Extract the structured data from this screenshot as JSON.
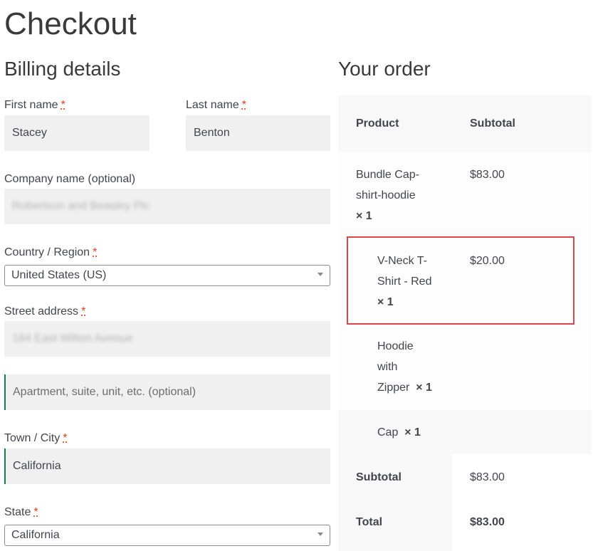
{
  "page": {
    "title": "Checkout"
  },
  "billing": {
    "title": "Billing details",
    "required_mark": "*",
    "first_name": {
      "label": "First name",
      "value": "Stacey"
    },
    "last_name": {
      "label": "Last name",
      "value": "Benton"
    },
    "company": {
      "label": "Company name (optional)",
      "value": "Robertson and Beasley Plc"
    },
    "country": {
      "label": "Country / Region",
      "value": "United States (US)"
    },
    "street": {
      "label": "Street address",
      "value": "184 East Wilton Avenue"
    },
    "apartment": {
      "placeholder": "Apartment, suite, unit, etc. (optional)"
    },
    "city": {
      "label": "Town / City",
      "value": "California"
    },
    "state": {
      "label": "State",
      "value": "California"
    }
  },
  "order": {
    "title": "Your order",
    "headers": {
      "product": "Product",
      "subtotal": "Subtotal"
    },
    "items": [
      {
        "name_lines": [
          "Bundle Cap-",
          "shirt-hoodie"
        ],
        "qty": "× 1",
        "subtotal": "$83.00"
      },
      {
        "name_lines": [
          "V-Neck T-",
          "Shirt - Red"
        ],
        "qty": "× 1",
        "subtotal": "$20.00"
      },
      {
        "name_lines": [
          "Hoodie",
          "with",
          "Zipper"
        ],
        "qty": "× 1",
        "subtotal": ""
      },
      {
        "name_lines": [
          "Cap"
        ],
        "qty": "× 1",
        "subtotal": ""
      }
    ],
    "subtotal": {
      "label": "Subtotal",
      "value": "$83.00"
    },
    "total": {
      "label": "Total",
      "value": "$83.00"
    }
  }
}
